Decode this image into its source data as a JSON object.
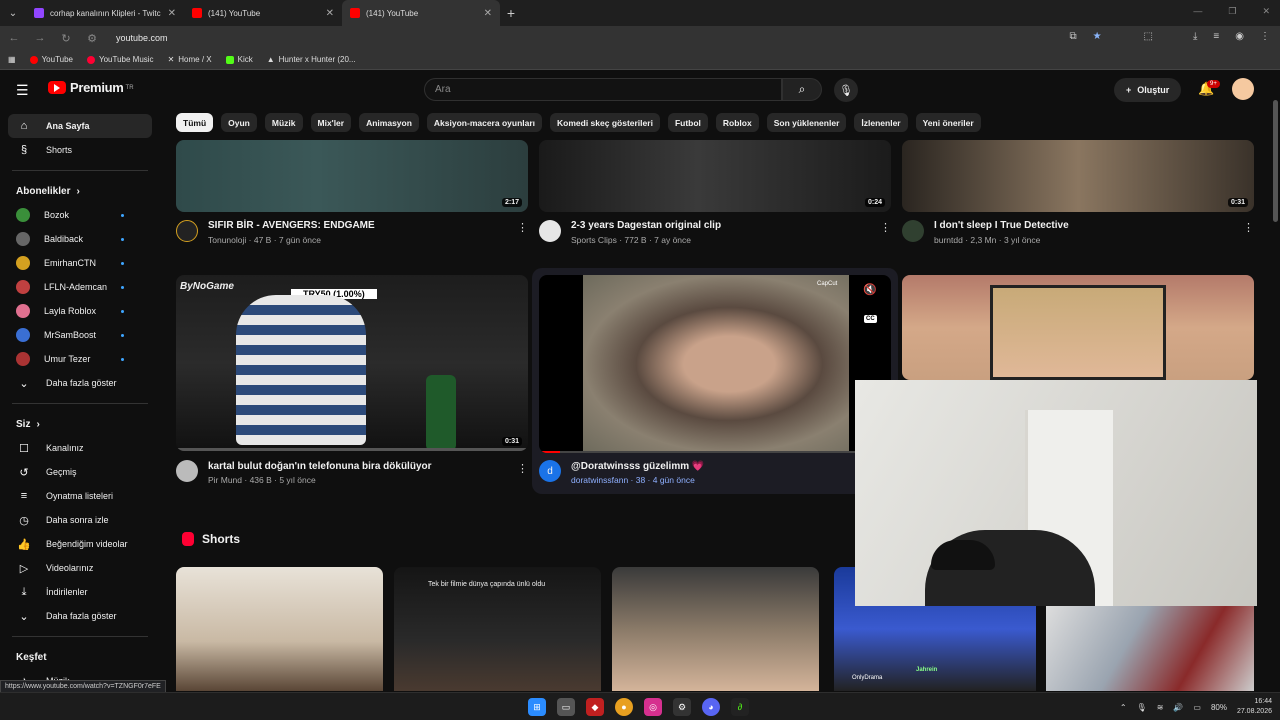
{
  "browser": {
    "tabs": [
      {
        "title": "corhap kanalının Klipleri - Twitc",
        "color": "#9146ff"
      },
      {
        "title": "(141) YouTube",
        "color": "#ff0000"
      },
      {
        "title": "(141) YouTube",
        "color": "#ff0000"
      }
    ],
    "url": "youtube.com",
    "bookmarks": [
      {
        "label": "YouTube",
        "color": "#ff0000"
      },
      {
        "label": "YouTube Music",
        "color": "#ff0033"
      },
      {
        "label": "Home / X",
        "color": "#000000"
      },
      {
        "label": "Kick",
        "color": "#53fc18"
      },
      {
        "label": "Hunter x Hunter (20...",
        "color": "#888888"
      }
    ]
  },
  "header": {
    "logo_text": "Premium",
    "logo_sup": "TR",
    "search_placeholder": "Ara",
    "create_label": "Oluştur",
    "notif_badge": "9+"
  },
  "sidebar": {
    "home": "Ana Sayfa",
    "shorts": "Shorts",
    "subs_title": "Abonelikler",
    "subs": [
      {
        "name": "Bozok",
        "color": "#3a8f3a"
      },
      {
        "name": "Baldiback",
        "color": "#666666"
      },
      {
        "name": "EmirhanCTN",
        "color": "#d4a020"
      },
      {
        "name": "LFLN-Ademcan",
        "color": "#c04040"
      },
      {
        "name": "Layla Roblox",
        "color": "#e07090"
      },
      {
        "name": "MrSamBoost",
        "color": "#3a6fd4"
      },
      {
        "name": "Umur Tezer",
        "color": "#aa3333"
      }
    ],
    "subs_more": "Daha fazla göster",
    "you_title": "Siz",
    "you_items": [
      {
        "label": "Kanalınız",
        "icon": "☐"
      },
      {
        "label": "Geçmiş",
        "icon": "↺"
      },
      {
        "label": "Oynatma listeleri",
        "icon": "≡"
      },
      {
        "label": "Daha sonra izle",
        "icon": "◷"
      },
      {
        "label": "Beğendiğim videolar",
        "icon": "👍"
      },
      {
        "label": "Videolarınız",
        "icon": "▷"
      },
      {
        "label": "İndirilenler",
        "icon": "⤓"
      },
      {
        "label": "Daha fazla göster",
        "icon": "⌄"
      }
    ],
    "explore_title": "Keşfet",
    "explore_items": [
      {
        "label": "Müzik",
        "icon": "♪"
      }
    ]
  },
  "chips": [
    "Tümü",
    "Oyun",
    "Müzik",
    "Mix'ler",
    "Animasyon",
    "Aksiyon-macera oyunları",
    "Komedi skeç gösterileri",
    "Futbol",
    "Roblox",
    "Son yüklenenler",
    "İzlenenler",
    "Yeni öneriler"
  ],
  "videos_row1": [
    {
      "title": "SIFIR BİR - AVENGERS: ENDGAME",
      "channel": "Tonunoloji",
      "meta": "47 B · 7 gün önce",
      "duration": "2:17"
    },
    {
      "title": "2-3 years Dagestan original clip",
      "channel": "Sports Clips",
      "meta": "772 B · 7 ay önce",
      "duration": "0:24"
    },
    {
      "title": "I don't sleep  I True Detective",
      "channel": "burntdd",
      "meta": "2,3 Mn · 3 yıl önce",
      "duration": "0:31"
    }
  ],
  "videos_row2": [
    {
      "title": "kartal bulut doğan'ın telefonuna bira dökülüyor",
      "channel": "Pir Mund",
      "meta": "436 B · 5 yıl önce",
      "duration": "0:31",
      "overlay_top": "ByNoGame",
      "overlay_banner": "TRY50 (1.00%)"
    },
    {
      "title": "@Doratwinsss güzelimm 💗",
      "channel": "doratwinssfann",
      "meta": "38 · 4 gün önce",
      "avatar_letter": "d",
      "capcut": "CapCut"
    }
  ],
  "shorts": {
    "title": "Shorts",
    "caption2": "Tek bir filmie dünya çapında ünlü oldu",
    "caption4a": "OnlyDrama",
    "caption4b": "Jahrein"
  },
  "status_url": "https://www.youtube.com/watch?v=TZNGF0r7eFE",
  "taskbar": {
    "time": "16:44",
    "date": "27.08.2026",
    "battery": "80%"
  }
}
